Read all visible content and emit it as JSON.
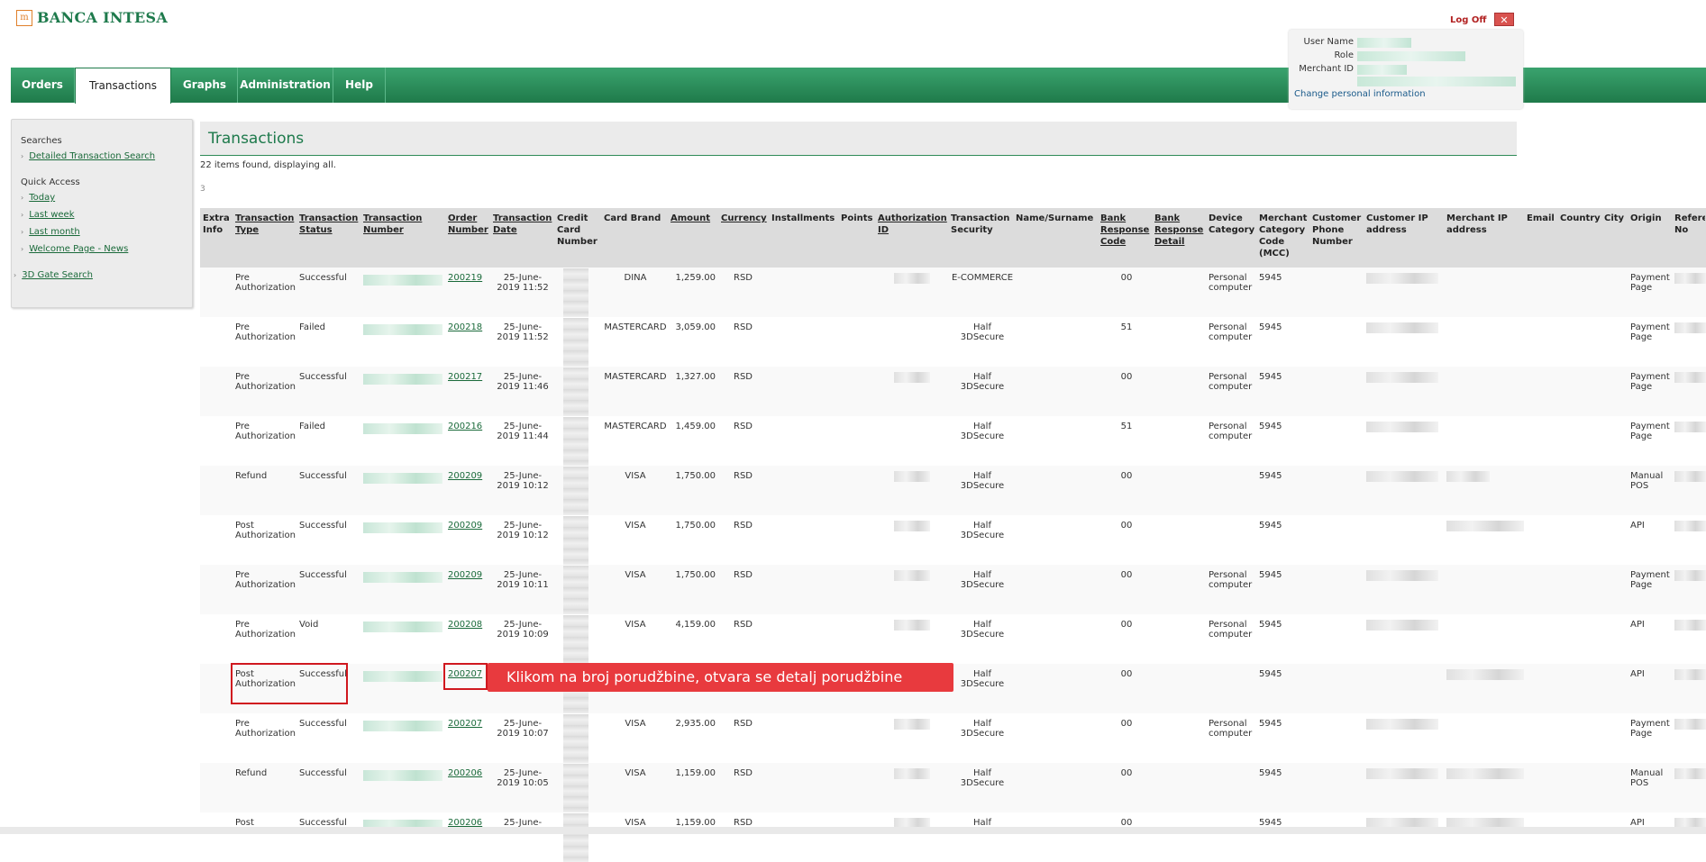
{
  "brand": {
    "logo_mark": "m",
    "name": "BANCA INTESA"
  },
  "logoff": {
    "label": "Log Off",
    "icon": "close-icon"
  },
  "userbox": {
    "user_name_label": "User Name",
    "role_label": "Role",
    "merchant_id_label": "Merchant ID",
    "change_link": "Change personal information"
  },
  "nav": [
    {
      "label": "Orders"
    },
    {
      "label": "Transactions"
    },
    {
      "label": "Graphs"
    },
    {
      "label": "Administration"
    },
    {
      "label": "Help"
    }
  ],
  "sidebar": {
    "searches_head": "Searches",
    "detailed": "Detailed Transaction Search",
    "quick_head": "Quick Access",
    "today": "Today",
    "last_week": "Last week",
    "last_month": "Last month",
    "welcome": "Welcome Page - News",
    "gate": "3D Gate Search"
  },
  "page": {
    "title": "Transactions",
    "found": "22 items found, displaying all.",
    "page_num": "3"
  },
  "columns": {
    "extra": "Extra Info",
    "type": "Transaction Type",
    "status": "Transaction Status",
    "number": "Transaction Number",
    "order": "Order Number",
    "date": "Transaction Date",
    "cc": "Credit Card Number",
    "brand": "Card Brand",
    "amount": "Amount",
    "currency": "Currency",
    "installments": "Installments",
    "points": "Points",
    "auth": "Authorization ID",
    "security": "Transaction Security",
    "name": "Name/Surname",
    "bank_code": "Bank Response Code",
    "bank_detail": "Bank Response Detail",
    "device": "Device Category",
    "mcc": "Merchant Category Code (MCC)",
    "phone": "Customer Phone Number",
    "cust_ip": "Customer IP address",
    "merch_ip": "Merchant IP address",
    "email": "Email",
    "country": "Country",
    "city": "City",
    "origin": "Origin",
    "ref": "Refere No"
  },
  "rows": [
    {
      "type": "Pre Authorization",
      "status": "Successful",
      "order": "200219",
      "date": "25-June-2019 11:52",
      "brand": "DINA",
      "amount": "1,259.00",
      "currency": "RSD",
      "security": "E-COMMERCE",
      "code": "00",
      "device": "Personal computer",
      "mcc": "5945",
      "origin": "Payment Page"
    },
    {
      "type": "Pre Authorization",
      "status": "Failed",
      "order": "200218",
      "date": "25-June-2019 11:52",
      "brand": "MASTERCARD",
      "amount": "3,059.00",
      "currency": "RSD",
      "security": "Half 3DSecure",
      "code": "51",
      "device": "Personal computer",
      "mcc": "5945",
      "origin": "Payment Page"
    },
    {
      "type": "Pre Authorization",
      "status": "Successful",
      "order": "200217",
      "date": "25-June-2019 11:46",
      "brand": "MASTERCARD",
      "amount": "1,327.00",
      "currency": "RSD",
      "security": "Half 3DSecure",
      "code": "00",
      "device": "Personal computer",
      "mcc": "5945",
      "origin": "Payment Page"
    },
    {
      "type": "Pre Authorization",
      "status": "Failed",
      "order": "200216",
      "date": "25-June-2019 11:44",
      "brand": "MASTERCARD",
      "amount": "1,459.00",
      "currency": "RSD",
      "security": "Half 3DSecure",
      "code": "51",
      "device": "Personal computer",
      "mcc": "5945",
      "origin": "Payment Page"
    },
    {
      "type": "Refund",
      "status": "Successful",
      "order": "200209",
      "date": "25-June-2019 10:12",
      "brand": "VISA",
      "amount": "1,750.00",
      "currency": "RSD",
      "security": "Half 3DSecure",
      "code": "00",
      "device": "",
      "mcc": "5945",
      "origin": "Manual POS"
    },
    {
      "type": "Post Authorization",
      "status": "Successful",
      "order": "200209",
      "date": "25-June-2019 10:12",
      "brand": "VISA",
      "amount": "1,750.00",
      "currency": "RSD",
      "security": "Half 3DSecure",
      "code": "00",
      "device": "",
      "mcc": "5945",
      "origin": "API"
    },
    {
      "type": "Pre Authorization",
      "status": "Successful",
      "order": "200209",
      "date": "25-June-2019 10:11",
      "brand": "VISA",
      "amount": "1,750.00",
      "currency": "RSD",
      "security": "Half 3DSecure",
      "code": "00",
      "device": "Personal computer",
      "mcc": "5945",
      "origin": "Payment Page"
    },
    {
      "type": "Pre Authorization",
      "status": "Void",
      "order": "200208",
      "date": "25-June-2019 10:09",
      "brand": "VISA",
      "amount": "4,159.00",
      "currency": "RSD",
      "security": "Half 3DSecure",
      "code": "00",
      "device": "Personal computer",
      "mcc": "5945",
      "origin": "API"
    },
    {
      "type": "Post Authorization",
      "status": "Successful",
      "order": "200207",
      "date": "",
      "brand": "",
      "amount": "",
      "currency": "",
      "security": "Half 3DSecure",
      "code": "00",
      "device": "",
      "mcc": "5945",
      "origin": "API"
    },
    {
      "type": "Pre Authorization",
      "status": "Successful",
      "order": "200207",
      "date": "25-June-2019 10:07",
      "brand": "VISA",
      "amount": "2,935.00",
      "currency": "RSD",
      "security": "Half 3DSecure",
      "code": "00",
      "device": "Personal computer",
      "mcc": "5945",
      "origin": "Payment Page"
    },
    {
      "type": "Refund",
      "status": "Successful",
      "order": "200206",
      "date": "25-June-2019 10:05",
      "brand": "VISA",
      "amount": "1,159.00",
      "currency": "RSD",
      "security": "Half 3DSecure",
      "code": "00",
      "device": "",
      "mcc": "5945",
      "origin": "Manual POS"
    },
    {
      "type": "Post",
      "status": "Successful",
      "order": "200206",
      "date": "25-June-",
      "brand": "VISA",
      "amount": "1,159.00",
      "currency": "RSD",
      "security": "Half",
      "code": "00",
      "device": "",
      "mcc": "5945",
      "origin": "API"
    }
  ],
  "tooltip": {
    "text": "Klikom na broj porudžbine, otvara se detalj porudžbine"
  }
}
